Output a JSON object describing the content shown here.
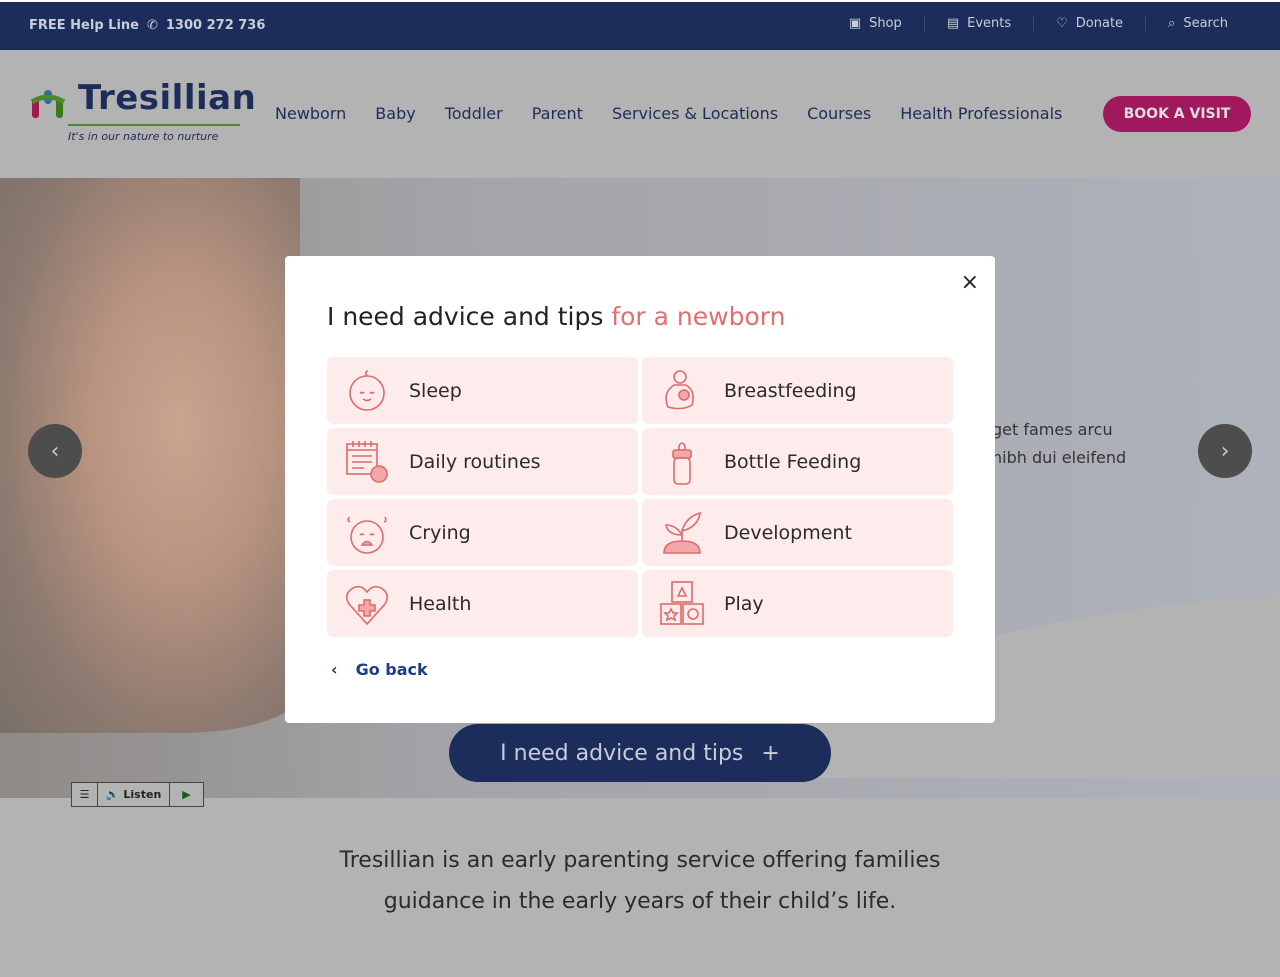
{
  "topbar": {
    "help_label": "FREE Help Line",
    "phone": "1300 272 736",
    "links": [
      {
        "label": "Shop",
        "icon": "bag-icon"
      },
      {
        "label": "Events",
        "icon": "calendar-icon"
      },
      {
        "label": "Donate",
        "icon": "heart-icon"
      },
      {
        "label": "Search",
        "icon": "search-icon"
      }
    ]
  },
  "header": {
    "logo_name": "Tresillian",
    "logo_tagline": "It's in our nature to nurture",
    "nav": [
      "Newborn",
      "Baby",
      "Toddler",
      "Parent",
      "Services & Locations",
      "Courses",
      "Health Professionals"
    ],
    "cta": "BOOK A VISIT"
  },
  "hero": {
    "text_line1": "get fames arcu",
    "text_line2": "nibh dui eleifend",
    "advice_button": "I need advice and tips",
    "advice_icon": "+"
  },
  "listen": {
    "label": "Listen"
  },
  "intro": {
    "line1": "Tresillian is an early parenting service offering families",
    "line2": "guidance in the early years of their child’s life."
  },
  "modal": {
    "title": "I need advice and tips",
    "title_accent": "for a newborn",
    "close": "×",
    "go_back": "Go back",
    "accent_color": "#e0706f",
    "tile_color": "#fdeceb",
    "topics": [
      {
        "label": "Sleep",
        "icon": "sleeping-baby-icon"
      },
      {
        "label": "Breastfeeding",
        "icon": "breastfeeding-icon"
      },
      {
        "label": "Daily routines",
        "icon": "calendar-clock-icon"
      },
      {
        "label": "Bottle Feeding",
        "icon": "baby-bottle-icon"
      },
      {
        "label": "Crying",
        "icon": "crying-baby-icon"
      },
      {
        "label": "Development",
        "icon": "sprout-icon"
      },
      {
        "label": "Health",
        "icon": "heart-cross-icon"
      },
      {
        "label": "Play",
        "icon": "toy-blocks-icon"
      }
    ]
  }
}
